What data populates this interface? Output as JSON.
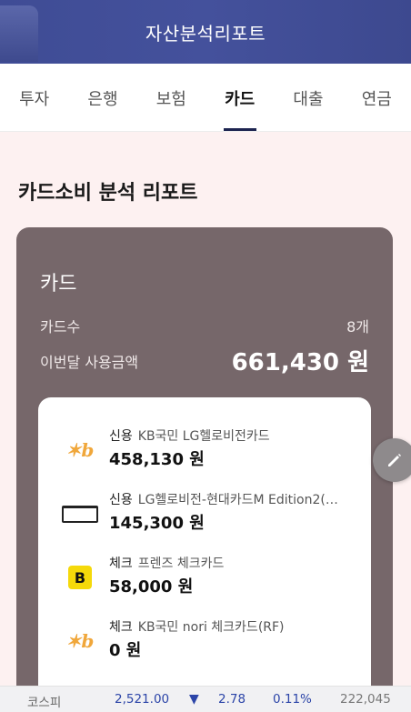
{
  "header": {
    "title": "자산분석리포트"
  },
  "tabs": [
    {
      "label": "투자",
      "active": false
    },
    {
      "label": "은행",
      "active": false
    },
    {
      "label": "보험",
      "active": false
    },
    {
      "label": "카드",
      "active": true
    },
    {
      "label": "대출",
      "active": false
    },
    {
      "label": "연금",
      "active": false
    }
  ],
  "report": {
    "title": "카드소비 분석 리포트"
  },
  "card_summary": {
    "heading": "카드",
    "count_label": "카드수",
    "count_value": "8개",
    "amount_label": "이번달 사용금액",
    "amount_value": "661,430 원"
  },
  "cards": [
    {
      "type": "신용",
      "name": "KB국민 LG헬로비전카드",
      "amount": "458,130 원",
      "logo": "kb-logo"
    },
    {
      "type": "신용",
      "name": "LG헬로비전-현대카드M Edition2(…",
      "amount": "145,300 원",
      "logo": "card-image"
    },
    {
      "type": "체크",
      "name": "프렌즈 체크카드",
      "amount": "58,000 원",
      "logo": "friends-b-logo"
    },
    {
      "type": "체크",
      "name": "KB국민 nori 체크카드(RF)",
      "amount": "0 원",
      "logo": "kb-logo"
    }
  ],
  "ticker": {
    "name": "코스피",
    "value": "2,521.00",
    "direction": "▼",
    "change": "2.78",
    "percent": "0.11%",
    "volume": "222,045"
  },
  "colors": {
    "header": "#44519c",
    "panel": "#76676a",
    "background": "#fdf1f1",
    "down": "#2c45a8",
    "kb": "#f0a73b",
    "friends": "#f5d90a"
  }
}
